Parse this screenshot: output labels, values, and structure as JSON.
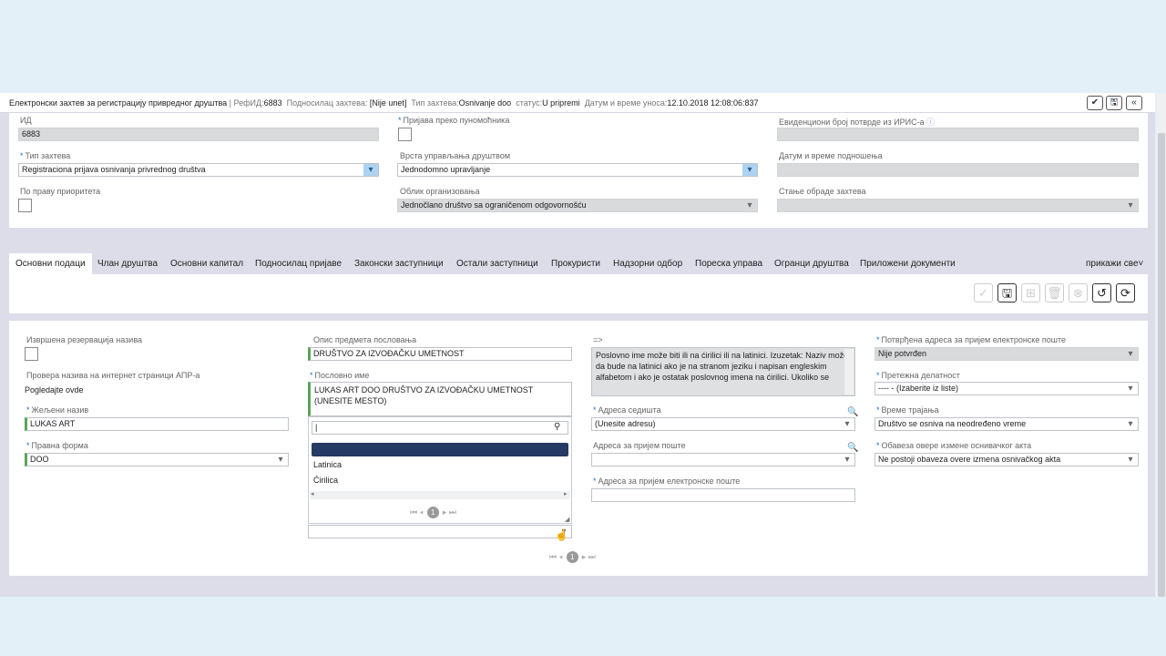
{
  "header": {
    "title": "Електронски захтев за регистрацију привредног друштва",
    "ref_label": " | РефИД:",
    "ref_value": "6883",
    "applicant_label": "Подносилац захтева:",
    "applicant_value": "[Nije unet]",
    "type_label": "Тип захтева:",
    "type_value": "Osnivanje doo",
    "status_label": "статус:",
    "status_value": "U pripremi",
    "datetime_label": "Датум и време уноса:",
    "datetime_value": "12.10.2018 12:08:06:837",
    "btn_confirm": "✔",
    "btn_save": "🖫",
    "btn_collapse": "«"
  },
  "top_form": {
    "id_label": "ИД",
    "id_value": "6883",
    "proxy_label": "Пријава преко пуномоћника",
    "iris_label": "Евиденциони број потврде из ИРИС-а",
    "request_type_label": "Тип захтева",
    "request_type_value": "Registraciona prijava osnivanja privrednog društva",
    "management_label": "Врста управљања друштвом",
    "management_value": "Jednodomno upravljanje",
    "submit_datetime_label": "Датум и време подношења",
    "priority_label": "По праву приоритета",
    "org_form_label": "Облик организовања",
    "org_form_value": "Jednočlano društvo sa ograničenom odgovornošću",
    "processing_label": "Стање обраде захтева"
  },
  "tabs": {
    "items": [
      {
        "label": "Основни подаци"
      },
      {
        "label": "Члан друштва"
      },
      {
        "label": "Основни капитал"
      },
      {
        "label": "Подносилац пријаве"
      },
      {
        "label": "Законски заступници"
      },
      {
        "label": "Остали заступници"
      },
      {
        "label": "Прокуристи"
      },
      {
        "label": "Надзорни одбор"
      },
      {
        "label": "Пореска управа"
      },
      {
        "label": "Огранци друштва"
      },
      {
        "label": "Приложени документи"
      }
    ],
    "show_all": "прикажи све"
  },
  "main_form": {
    "reservation_label": "Извршена резервација назива",
    "apr_check_label": "Провера назива на интернет страници АПР-а",
    "apr_check_link": "Pogledajte ovde",
    "desired_name_label": "Жељени назив",
    "desired_name_value": "LUKAS ART",
    "legal_form_label": "Правна форма",
    "legal_form_value": "DOO",
    "activity_desc_label": "Опис предмета пословања",
    "activity_desc_value": "DRUŠTVO ZA IZVOĐAČKU UMETNOST",
    "business_name_label": "Пословно име",
    "business_name_value": "LUKAS ART DOO DRUŠTVO ZA IZVOĐAČKU UMETNOST (UNESITE MESTO)",
    "arrow_label": "=>",
    "note_text": "Poslovno ime može biti ili na ćirilici ili na latinici. Izuzetak: Naziv može da bude na latinici ako je na stranom jeziku i napisan engleskim alfabetom i ako je ostatak poslovnog imena na ćirilici. Ukoliko se",
    "seat_address_label": "Адреса седишта",
    "seat_address_value": "(Unesite adresu)",
    "mail_address_label": "Адреса за пријем поште",
    "email_address_label": "Адреса за пријем електронске поште",
    "confirmed_email_label": "Потврђена адреса за пријем електронске поште",
    "confirmed_email_value": "Nije potvrđen",
    "main_activity_label": "Претежна делатност",
    "main_activity_value": "---- - (Izaberite iz liste)",
    "duration_label": "Време трајања",
    "duration_value": "Društvo se osniva na neodređeno vreme",
    "verification_label": "Обавеза овере измене оснивачког акта",
    "verification_value": "Ne postoji obaveza overe izmena osnivačkog akta"
  },
  "dropdown": {
    "search_placeholder": "",
    "options": [
      {
        "label": "Latinica"
      },
      {
        "label": "Ćirilica"
      }
    ],
    "page": "1"
  },
  "pager": {
    "page": "1"
  }
}
